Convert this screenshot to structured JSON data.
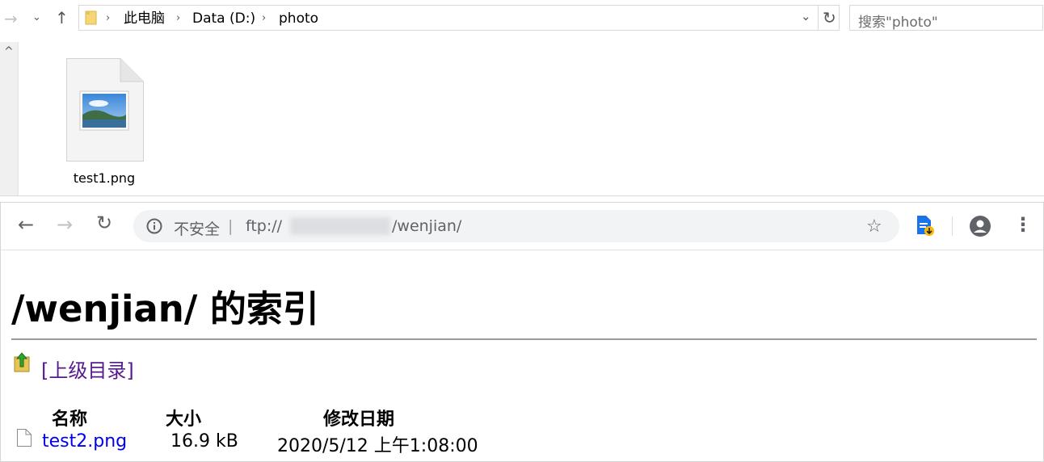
{
  "explorer": {
    "breadcrumb": [
      "此电脑",
      "Data (D:)",
      "photo"
    ],
    "search_placeholder": "搜索\"photo\"",
    "file": {
      "name": "test1.png"
    }
  },
  "browser": {
    "security_label": "不安全",
    "url_prefix": "ftp://",
    "url_suffix": "/wenjian/",
    "page": {
      "heading": "/wenjian/ 的索引",
      "parent_link": "[上级目录]",
      "columns": [
        "名称",
        "大小",
        "修改日期"
      ],
      "rows": [
        {
          "name": "test2.png",
          "size": "16.9 kB",
          "modified": "2020/5/12 上午1:08:00"
        }
      ]
    }
  },
  "colors": {
    "link": "#0000ee",
    "visited": "#551a8b"
  }
}
